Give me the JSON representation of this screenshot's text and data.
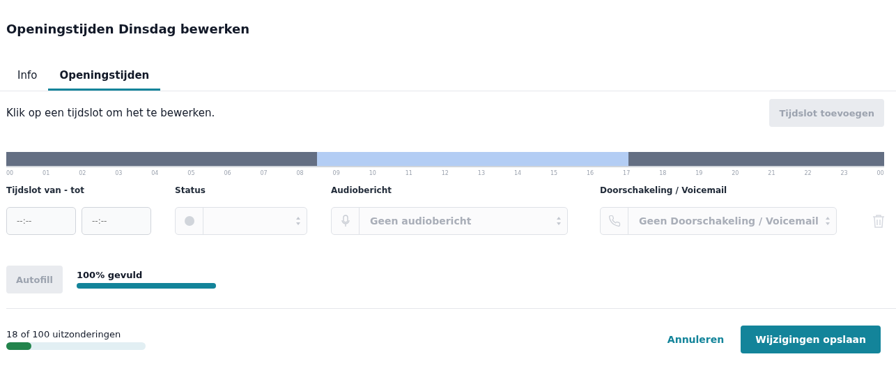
{
  "title": "Openingstijden Dinsdag bewerken",
  "tabs": [
    {
      "label": "Info",
      "selected": false
    },
    {
      "label": "Openingstijden",
      "selected": true
    }
  ],
  "instruction": "Klik op een tijdslot om het te bewerken.",
  "add_button": {
    "label": "Tijdslot toevoegen",
    "disabled": true
  },
  "timeline": {
    "segments": [
      {
        "kind": "closed"
      },
      {
        "kind": "open"
      },
      {
        "kind": "closed"
      }
    ],
    "ticks": [
      "00",
      "01",
      "02",
      "03",
      "04",
      "05",
      "06",
      "07",
      "08",
      "09",
      "10",
      "11",
      "12",
      "13",
      "14",
      "15",
      "16",
      "17",
      "18",
      "19",
      "20",
      "21",
      "22",
      "23",
      "00"
    ]
  },
  "slot_form": {
    "time_label": "Tijdslot van - tot",
    "time_from": {
      "placeholder": "--:--",
      "disabled": true
    },
    "time_to": {
      "placeholder": "--:--",
      "disabled": true
    },
    "status_label": "Status",
    "status": {
      "disabled": true
    },
    "audio_label": "Audiobericht",
    "audio": {
      "placeholder": "Geen audiobericht",
      "disabled": true
    },
    "forward_label": "Doorschakeling / Voicemail",
    "forward": {
      "placeholder": "Geen Doorschakeling / Voicemail",
      "disabled": true
    }
  },
  "autofill": {
    "label": "Autofill",
    "disabled": true
  },
  "fill": {
    "label": "100% gevuld",
    "level": 1.0
  },
  "exceptions": {
    "label": "18 of 100 uitzonderingen",
    "level": 0.18
  },
  "cancel": "Annuleren",
  "save": "Wijzigingen opslaan"
}
